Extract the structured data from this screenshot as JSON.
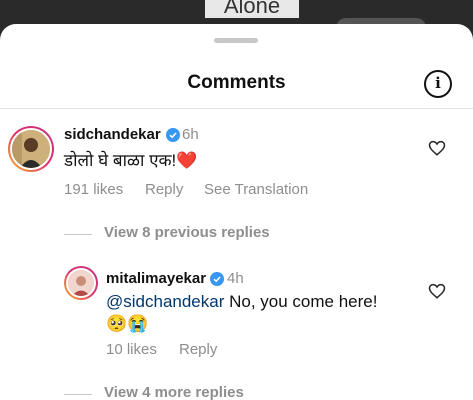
{
  "background": {
    "caption": "Alone"
  },
  "header": {
    "title": "Comments",
    "info_icon": "info-icon"
  },
  "comments": [
    {
      "username": "sidchandekar",
      "time": "6h",
      "text": "डोलो घे बाळा एक!",
      "emoji": "❤️",
      "likes": "191 likes",
      "reply": "Reply",
      "translate": "See Translation"
    }
  ],
  "view_previous": "View 8 previous replies",
  "reply_comment": {
    "username": "mitalimayekar",
    "time": "4h",
    "mention": "@sidchandekar",
    "text": " No, you come here!",
    "emoji": "🥺😭",
    "likes": "10 likes",
    "reply": "Reply"
  },
  "view_more": "View 4 more replies",
  "colors": {
    "verified": "#3897f0",
    "heart": "#ed4956",
    "mention": "#00376b"
  }
}
